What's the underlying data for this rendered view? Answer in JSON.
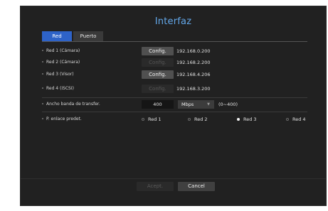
{
  "title": "Interfaz",
  "tabs": [
    {
      "label": "Red",
      "active": true
    },
    {
      "label": "Puerto",
      "active": false
    }
  ],
  "networks": [
    {
      "label": "Red 1 (Cámara)",
      "button": "Config.",
      "enabled": true,
      "ip": "192.168.0.200"
    },
    {
      "label": "Red 2 (Cámara)",
      "button": "Config.",
      "enabled": false,
      "ip": "192.168.2.200"
    },
    {
      "label": "Red 3 (Visor)",
      "button": "Config.",
      "enabled": true,
      "ip": "192.168.4.206"
    },
    {
      "label": "Red 4 (iSCSI)",
      "button": "Config.",
      "enabled": false,
      "ip": "192.168.3.200"
    }
  ],
  "bandwidth": {
    "label": "Ancho banda de transfer.",
    "value": "400",
    "unit": "Mbps",
    "range": "(0~400)"
  },
  "default_link": {
    "label": "P. enlace predet.",
    "options": [
      "Red 1",
      "Red 2",
      "Red 3",
      "Red 4"
    ],
    "selected": "Red 3"
  },
  "footer": {
    "accept": "Acept.",
    "cancel": "Cancel"
  },
  "colors": {
    "title": "#63a8ea",
    "active_tab": "#2e63c8",
    "background": "#212121"
  }
}
